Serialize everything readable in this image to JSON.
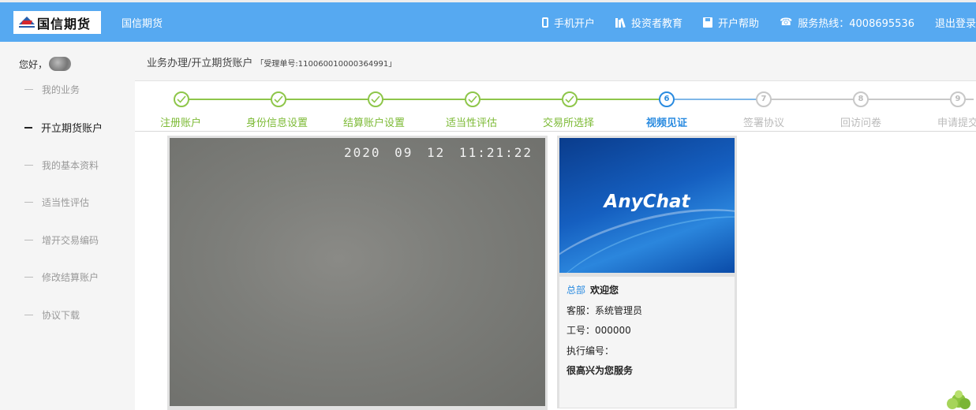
{
  "header": {
    "logo_text": "国信期货",
    "brand": "国信期货",
    "nav": [
      {
        "icon": "phone-icon",
        "label": "手机开户"
      },
      {
        "icon": "books-icon",
        "label": "投资者教育"
      },
      {
        "icon": "save-icon",
        "label": "开户帮助"
      },
      {
        "icon": "telephone-icon",
        "label": "服务热线：4008695536"
      },
      {
        "label": "退出登录"
      }
    ],
    "colors": {
      "bar": "#56a9f1"
    }
  },
  "sidebar": {
    "greeting": "您好，",
    "items": [
      {
        "label": "我的业务",
        "active": false
      },
      {
        "label": "开立期货账户",
        "active": true
      },
      {
        "label": "我的基本资料",
        "active": false
      },
      {
        "label": "适当性评估",
        "active": false
      },
      {
        "label": "增开交易编码",
        "active": false
      },
      {
        "label": "修改结算账户",
        "active": false
      },
      {
        "label": "协议下载",
        "active": false
      }
    ]
  },
  "breadcrumb": {
    "path": "业务办理/开立期货账户",
    "ticket": "「受理单号:110060010000364991」"
  },
  "steps": [
    {
      "label": "注册账户",
      "state": "done"
    },
    {
      "label": "身份信息设置",
      "state": "done"
    },
    {
      "label": "结算账户设置",
      "state": "done"
    },
    {
      "label": "适当性评估",
      "state": "done"
    },
    {
      "label": "交易所选择",
      "state": "done"
    },
    {
      "label": "视频见证",
      "number": "6",
      "state": "current"
    },
    {
      "label": "签署协议",
      "number": "7",
      "state": "future"
    },
    {
      "label": "回访问卷",
      "number": "8",
      "state": "future"
    },
    {
      "label": "申请提交",
      "number": "9",
      "state": "future"
    }
  ],
  "video": {
    "timestamp": "2020 09 12 11:21:22"
  },
  "agent": {
    "logo_word": "AnyChat",
    "branch": "总部",
    "welcome": "欢迎您",
    "service": "客服：系统管理员",
    "employee_id": "工号：000000",
    "exec_no": "执行编号：",
    "closing": "很高兴为您服务"
  }
}
